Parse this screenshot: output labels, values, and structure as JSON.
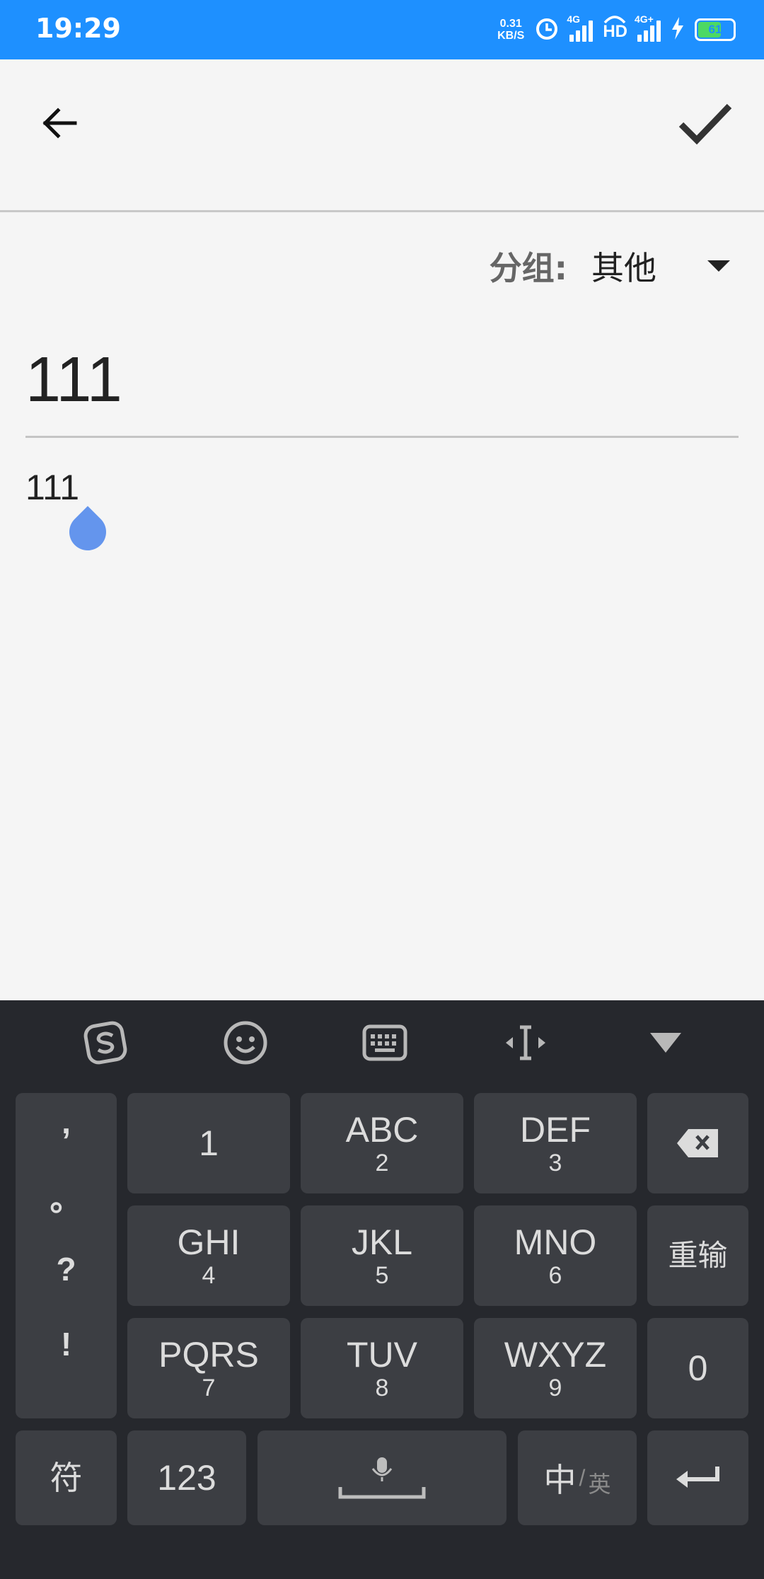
{
  "status_bar": {
    "time": "19:29",
    "net_speed_value": "0.31",
    "net_speed_unit": "KB/S",
    "signal1_label": "4G",
    "hd_label": "HD",
    "signal2_label": "4G+",
    "battery_percent": "61",
    "bg_color": "#1e90ff"
  },
  "app_bar": {
    "back_icon": "arrow-left-icon",
    "save_icon": "check-icon"
  },
  "group": {
    "label": "分组:",
    "value": "其他"
  },
  "note": {
    "title": "111",
    "body": "111"
  },
  "keyboard": {
    "toolbar_icons": [
      "sogou-logo-icon",
      "emoji-icon",
      "keyboard-icon",
      "cursor-move-icon",
      "collapse-icon"
    ],
    "symbols": [
      ",",
      "。",
      "?",
      "!"
    ],
    "keys": {
      "k1": {
        "main": "1",
        "sub": ""
      },
      "k2": {
        "main": "ABC",
        "sub": "2"
      },
      "k3": {
        "main": "DEF",
        "sub": "3"
      },
      "k4": {
        "main": "GHI",
        "sub": "4"
      },
      "k5": {
        "main": "JKL",
        "sub": "5"
      },
      "k6": {
        "main": "MNO",
        "sub": "6"
      },
      "k7": {
        "main": "PQRS",
        "sub": "7"
      },
      "k8": {
        "main": "TUV",
        "sub": "8"
      },
      "k9": {
        "main": "WXYZ",
        "sub": "9"
      },
      "k0": {
        "main": "0"
      }
    },
    "reenter_label": "重输",
    "symbol_key_label": "符",
    "num_key_label": "123",
    "lang_main": "中",
    "lang_sep": "/",
    "lang_alt": "英"
  }
}
